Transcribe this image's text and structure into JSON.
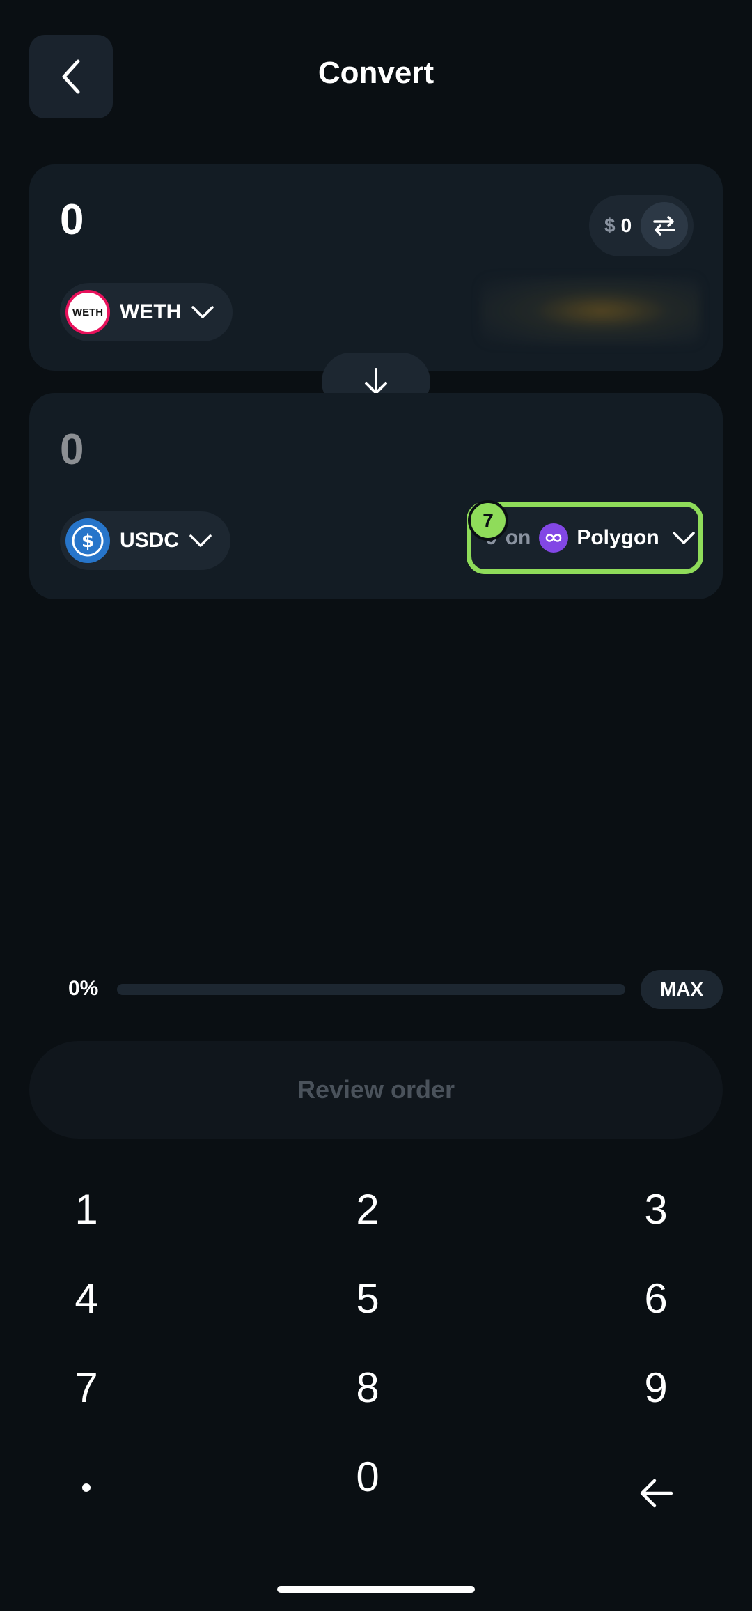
{
  "header": {
    "title": "Convert"
  },
  "from": {
    "amount": "0",
    "fiat_currency": "$",
    "fiat_value": "0",
    "token": {
      "symbol": "WETH",
      "logo_text": "WETH",
      "color": "#e8115b"
    }
  },
  "to": {
    "amount": "0",
    "token": {
      "symbol": "USDC",
      "color": "#2775ca"
    },
    "network": {
      "balance_hidden": "0",
      "on_text": "on",
      "name": "Polygon",
      "color": "#8247e5"
    }
  },
  "annotation_badge": "7",
  "slider": {
    "percent_label": "0%",
    "value": 0,
    "max_label": "MAX"
  },
  "review_button": {
    "label": "Review order"
  },
  "keypad": [
    "1",
    "2",
    "3",
    "4",
    "5",
    "6",
    "7",
    "8",
    "9",
    ".",
    "0",
    "backspace"
  ],
  "colors": {
    "accent": "#8fdc5a",
    "background": "#0a0f13",
    "card": "#131c24"
  }
}
